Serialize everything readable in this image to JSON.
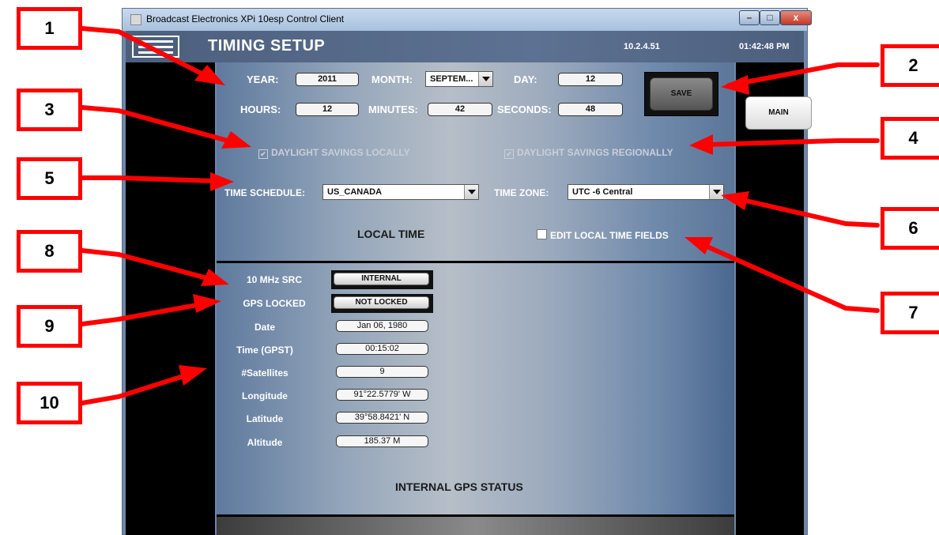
{
  "window": {
    "title": "Broadcast Electronics XPi 10esp Control Client",
    "minimize": "–",
    "maximize": "□",
    "close": "x"
  },
  "header": {
    "page_title": "TIMING SETUP",
    "ip_address": "10.2.4.51",
    "clock": "01:42:48 PM"
  },
  "date_time": {
    "year_label": "YEAR:",
    "year": "2011",
    "month_label": "MONTH:",
    "month": "SEPTEM...",
    "day_label": "DAY:",
    "day": "12",
    "hours_label": "HOURS:",
    "hours": "12",
    "minutes_label": "MINUTES:",
    "minutes": "42",
    "seconds_label": "SECONDS:",
    "seconds": "48"
  },
  "buttons": {
    "save": "SAVE",
    "main": "MAIN"
  },
  "daylight": {
    "locally": "DAYLIGHT SAVINGS LOCALLY",
    "regionally": "DAYLIGHT SAVINGS REGIONALLY",
    "check_mark": "✔"
  },
  "schedule": {
    "time_schedule_label": "TIME SCHEDULE:",
    "time_schedule": "US_CANADA",
    "time_zone_label": "TIME ZONE:",
    "time_zone": "UTC -6 Central"
  },
  "local_time": {
    "title": "LOCAL TIME",
    "edit_label": "EDIT LOCAL TIME FIELDS"
  },
  "gps": {
    "title": "INTERNAL GPS STATUS",
    "src_label": "10 MHz SRC",
    "src": "INTERNAL",
    "locked_label": "GPS LOCKED",
    "locked": "NOT LOCKED",
    "date_label": "Date",
    "date": "Jan 06, 1980",
    "time_label": "Time (GPST)",
    "time": "00:15:02",
    "sats_label": "#Satellites",
    "sats": "9",
    "lon_label": "Longitude",
    "lon": "91°22.5779' W",
    "lat_label": "Latitude",
    "lat": "39°58.8421' N",
    "alt_label": "Altitude",
    "alt": "185.37 M"
  },
  "callouts": [
    "1",
    "2",
    "3",
    "4",
    "5",
    "6",
    "7",
    "8",
    "9",
    "10"
  ],
  "colors": {
    "callout": "#ff0000",
    "panel": "#6f89ab"
  }
}
